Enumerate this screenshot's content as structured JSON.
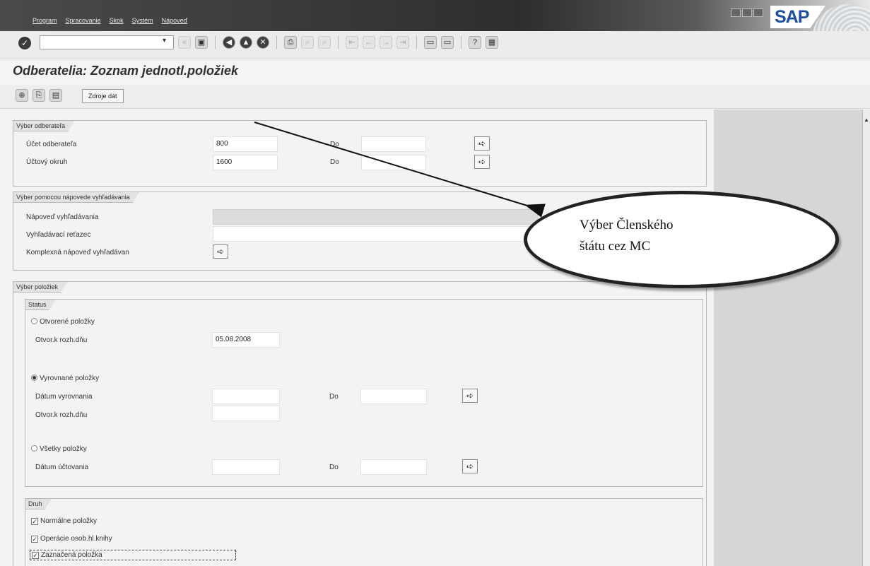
{
  "menu": [
    "Program",
    "Spracovanie",
    "Skok",
    "Systém",
    "Nápoveď"
  ],
  "brand": "SAP",
  "page_title": "Odberatelia: Zoznam jednotl.položiek",
  "app_toolbar": {
    "data_sources_label": "Zdroje dát"
  },
  "customer_selection": {
    "title": "Výber odberateľa",
    "account_label": "Účet odberateľa",
    "account_value": "800",
    "account_to_label": "Do",
    "group_label": "Účtový okruh",
    "group_value": "1600",
    "group_to_label": "Do"
  },
  "search_help": {
    "title": "Výber pomocou nápovede vyhľadávania",
    "help_label": "Nápoveď vyhľadávania",
    "string_label": "Vyhľadávací reťazec",
    "complex_label": "Komplexná nápoveď vyhľadávan"
  },
  "item_selection": {
    "title": "Výber položiek",
    "status": {
      "title": "Status",
      "open_items_label": "Otvorené položky",
      "open_key_date_label": "Otvor.k rozh.dňu",
      "open_key_date_value": "05.08.2008",
      "cleared_items_label": "Vyrovnané položky",
      "clearing_date_label": "Dátum vyrovnania",
      "clearing_date_to_label": "Do",
      "cleared_key_date_label": "Otvor.k rozh.dňu",
      "all_items_label": "Všetky položky",
      "posting_date_label": "Dátum účtovania",
      "posting_date_to_label": "Do"
    },
    "type": {
      "title": "Druh",
      "normal_items_label": "Normálne položky",
      "special_gl_label": "Operácie osob.hl.knihy",
      "noted_items_label": "Zaznačená položka"
    }
  },
  "callout": {
    "line1": "Výber Členského",
    "line2": "štátu cez MC"
  },
  "colors": {
    "titlebar": "#3a3a3a",
    "sap_blue": "#1c4fa0",
    "panel": "#f3f3f3"
  }
}
